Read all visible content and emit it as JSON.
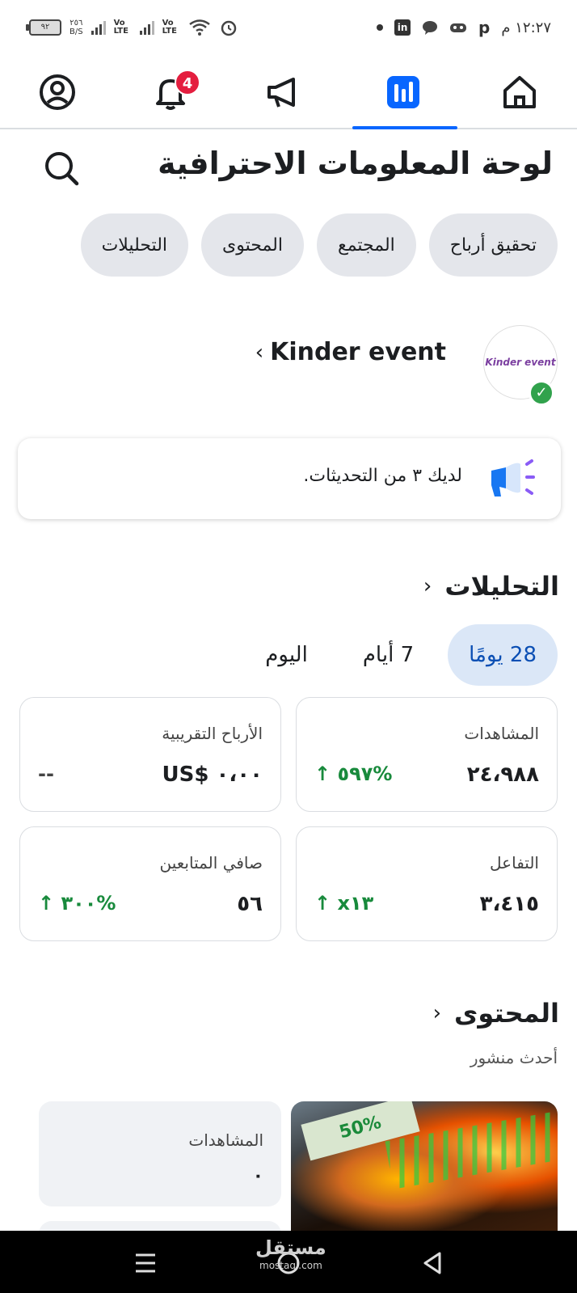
{
  "status_bar": {
    "time": "١٢:٢٧ م",
    "battery": "٩٢",
    "data_speed": "٢٥٦",
    "data_unit": "B/S",
    "lte1": "Vo LTE",
    "lte2": "Vo LTE",
    "notif_icons": [
      "p-icon",
      "game-icon",
      "chat-icon",
      "linkedin-icon",
      "dot-icon"
    ]
  },
  "top_nav": {
    "tabs": [
      "home-icon",
      "analytics-icon",
      "megaphone-icon",
      "bell-icon",
      "profile-icon"
    ],
    "active": "analytics-icon",
    "notifications_badge": "4",
    "accent": "#0866ff",
    "badge_color": "#e41e3f"
  },
  "header": {
    "title": "لوحة المعلومات الاحترافية"
  },
  "chips": [
    "التحليلات",
    "المحتوى",
    "المجتمع",
    "تحقيق أرباح"
  ],
  "profile": {
    "name": "Kinder event",
    "avatar_text": "Kinder event"
  },
  "updates": {
    "text": "لديك ٣ من التحديثات."
  },
  "analytics": {
    "title": "التحليلات",
    "time_tabs": [
      "28 يومًا",
      "7 أيام",
      "اليوم"
    ],
    "active_tab": "28 يومًا",
    "cards": [
      {
        "label": "المشاهدات",
        "value": "٢٤،٩٨٨",
        "change": "↑ ٥٩٧%"
      },
      {
        "label": "الأرباح التقريبية",
        "value": "US$ ٠،٠٠",
        "change": "--"
      },
      {
        "label": "التفاعل",
        "value": "٣،٤١٥",
        "change": "↑ x١٣"
      },
      {
        "label": "صافي المتابعين",
        "value": "٥٦",
        "change": "↑ ٣٠٠%"
      }
    ],
    "positive_color": "#188a3c"
  },
  "content": {
    "title": "المحتوى",
    "subtitle": "أحدث منشور",
    "views_label": "المشاهدات",
    "views_value": "٠",
    "thumb_sign": "50%"
  },
  "system_nav": {
    "buttons": [
      "menu-icon",
      "home-circle-icon",
      "back-icon"
    ],
    "watermark": "مستقل",
    "watermark_sub": "mostaql.com"
  }
}
